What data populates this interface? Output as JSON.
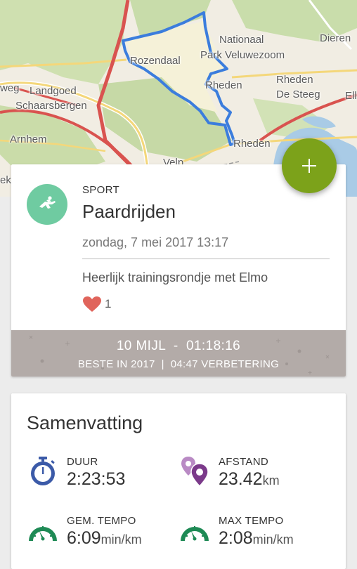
{
  "map": {
    "places": [
      "Nationaal",
      "Park Veluwezoom",
      "Dieren",
      "Rozendaal",
      "Rheden",
      "Rheden",
      "De Steeg",
      "Landgoed",
      "Schaarsbergen",
      "Arnhem",
      "Rheden",
      "Velp",
      "Ell",
      "weg",
      "ek"
    ]
  },
  "fab": {
    "icon": "plus-icon"
  },
  "activity": {
    "icon": "horse-riding-icon",
    "category": "SPORT",
    "sport": "Paardrijden",
    "date": "zondag, 7 mei 2017 13:17",
    "note": "Heerlijk trainingsrondje met Elmo",
    "likes": "1",
    "record": {
      "distance": "10 MIJL",
      "separator": "-",
      "time": "01:18:16",
      "best": "BESTE IN 2017",
      "divider": "|",
      "improvement": "04:47 VERBETERING"
    }
  },
  "summary": {
    "title": "Samenvatting",
    "stats": [
      {
        "label": "DUUR",
        "value": "2:23:53",
        "unit": "",
        "icon": "stopwatch-icon"
      },
      {
        "label": "AFSTAND",
        "value": "23.42",
        "unit": "km",
        "icon": "distance-pins-icon"
      },
      {
        "label": "GEM. TEMPO",
        "value": "6:09",
        "unit": "min/km",
        "icon": "speedometer-icon"
      },
      {
        "label": "MAX TEMPO",
        "value": "2:08",
        "unit": "min/km",
        "icon": "speedometer-icon"
      }
    ]
  },
  "colors": {
    "accent_fab": "#7ca21a",
    "sport_avatar": "#6fcba1",
    "route": "#3b7ddd",
    "heart": "#e0645b",
    "record_banner": "#b3aba8",
    "stopwatch": "#3b5aa8",
    "distance_pins": "#7b3a8a",
    "speedometer": "#1e8a55"
  }
}
